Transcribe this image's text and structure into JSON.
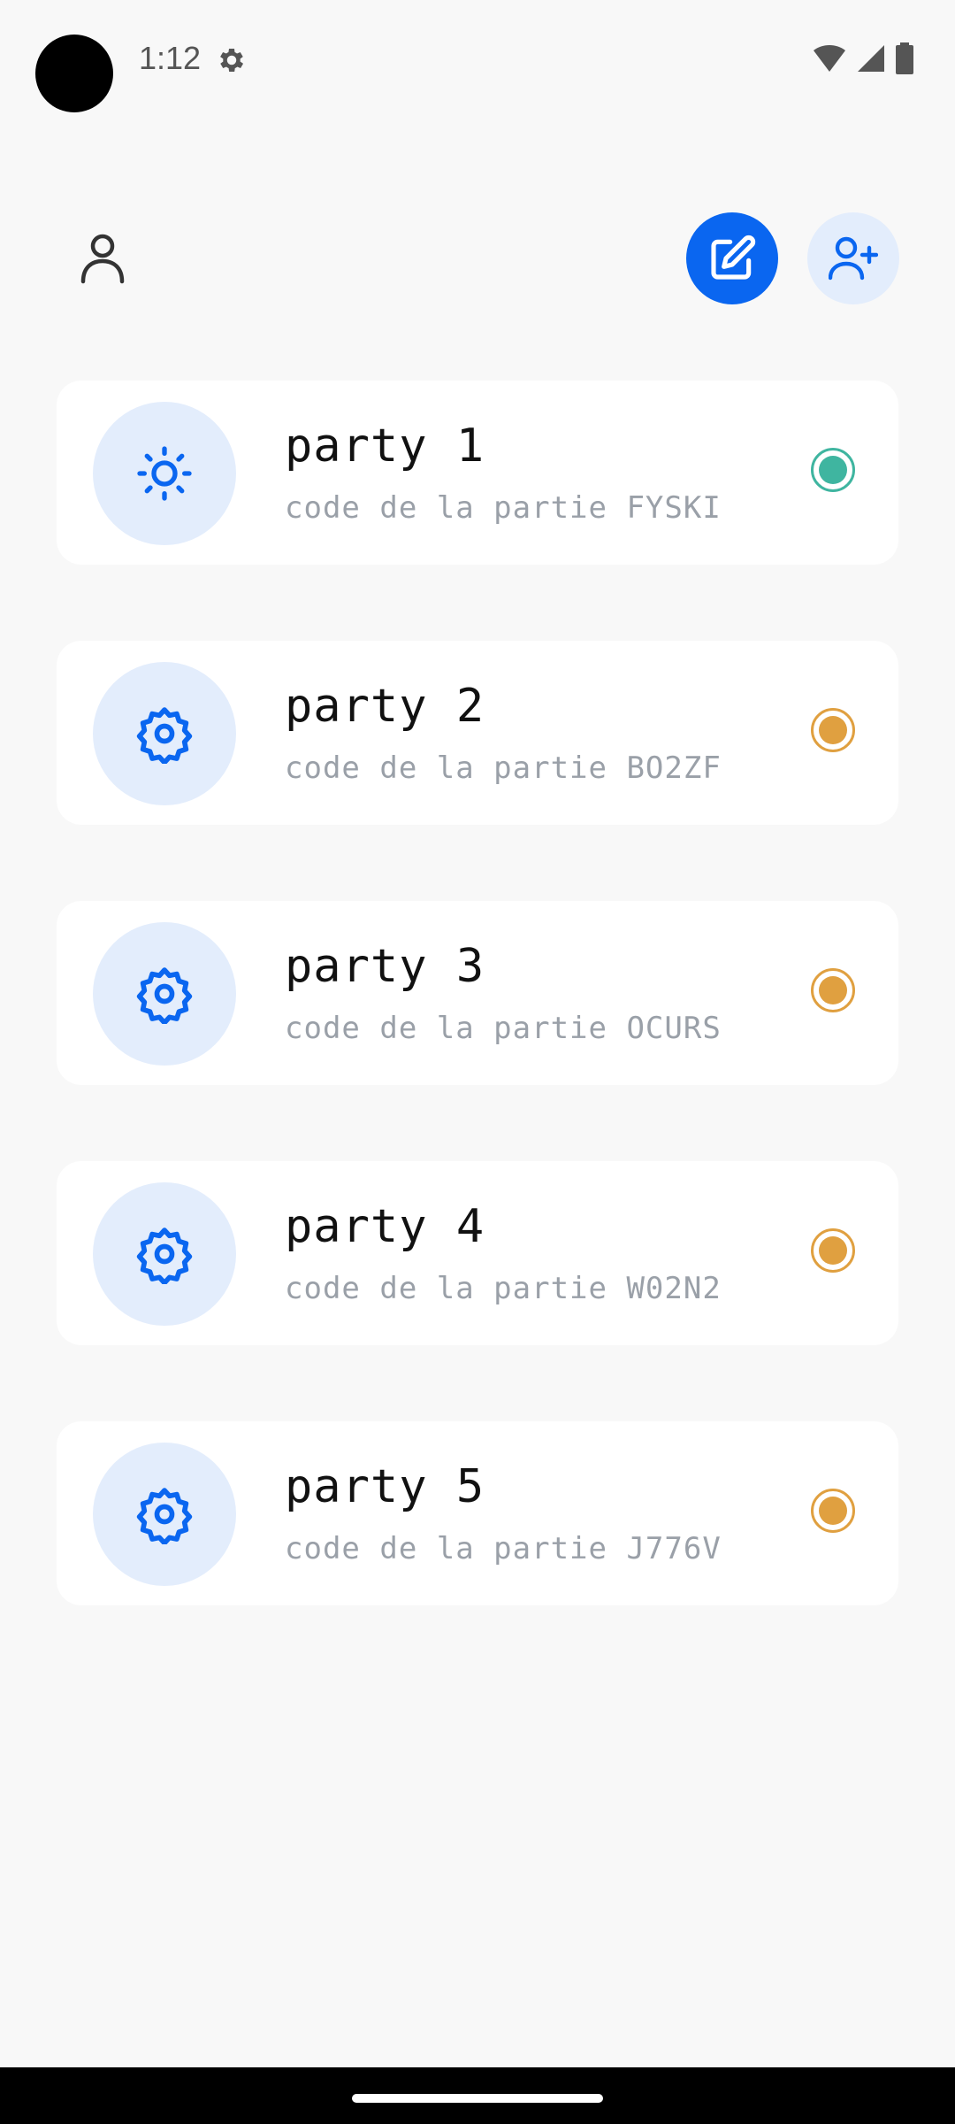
{
  "status_bar": {
    "time": "1:12",
    "icons": [
      "settings-icon",
      "wifi-icon",
      "signal-icon",
      "battery-icon"
    ]
  },
  "toolbar": {
    "profile_icon": "person-icon",
    "edit_icon": "edit-icon",
    "add_user_icon": "add-user-icon",
    "accent": "#0a66f0",
    "accent_light": "#e3edfc"
  },
  "parties": [
    {
      "name": "party 1",
      "code": "code de la partie FYSKI",
      "icon": "sun-icon",
      "status": "green"
    },
    {
      "name": "party 2",
      "code": "code de la partie BO2ZF",
      "icon": "gear-icon",
      "status": "orange"
    },
    {
      "name": "party 3",
      "code": "code de la partie OCURS",
      "icon": "gear-icon",
      "status": "orange"
    },
    {
      "name": "party 4",
      "code": "code de la partie W02N2",
      "icon": "gear-icon",
      "status": "orange"
    },
    {
      "name": "party 5",
      "code": "code de la partie J776V",
      "icon": "gear-icon",
      "status": "orange"
    }
  ],
  "status_colors": {
    "green": "#3fb5a0",
    "orange": "#e0a040"
  }
}
